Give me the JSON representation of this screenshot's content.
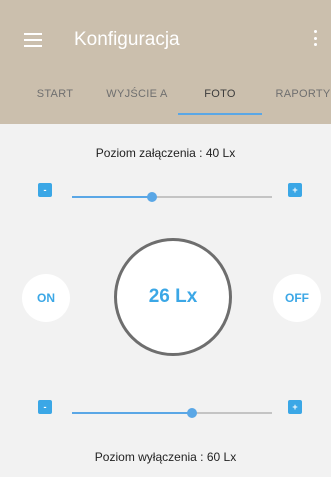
{
  "appbar": {
    "title": "Konfiguracja",
    "menu_icon": "hamburger-menu-icon",
    "overflow_icon": "overflow-menu-icon",
    "background_color": "#cbbfad"
  },
  "tabs": [
    {
      "label": "START",
      "active": false
    },
    {
      "label": "WYJŚCIE A",
      "active": false
    },
    {
      "label": "FOTO",
      "active": true
    },
    {
      "label": "RAPORTY",
      "active": false
    }
  ],
  "foto": {
    "on_level": {
      "label": "Poziom załączenia : 40 Lx",
      "slider_fraction": 0.4,
      "decrement_label": "-",
      "increment_label": "+"
    },
    "current": {
      "value_text": "26 Lx",
      "on_button": "ON",
      "off_button": "OFF"
    },
    "off_level": {
      "label": "Poziom wyłączenia : 60 Lx",
      "slider_fraction": 0.6,
      "decrement_label": "-",
      "increment_label": "+"
    }
  },
  "colors": {
    "accent": "#3ba7e6",
    "slider": "#5aa7e6",
    "dial_ring": "#6e6e6e"
  }
}
